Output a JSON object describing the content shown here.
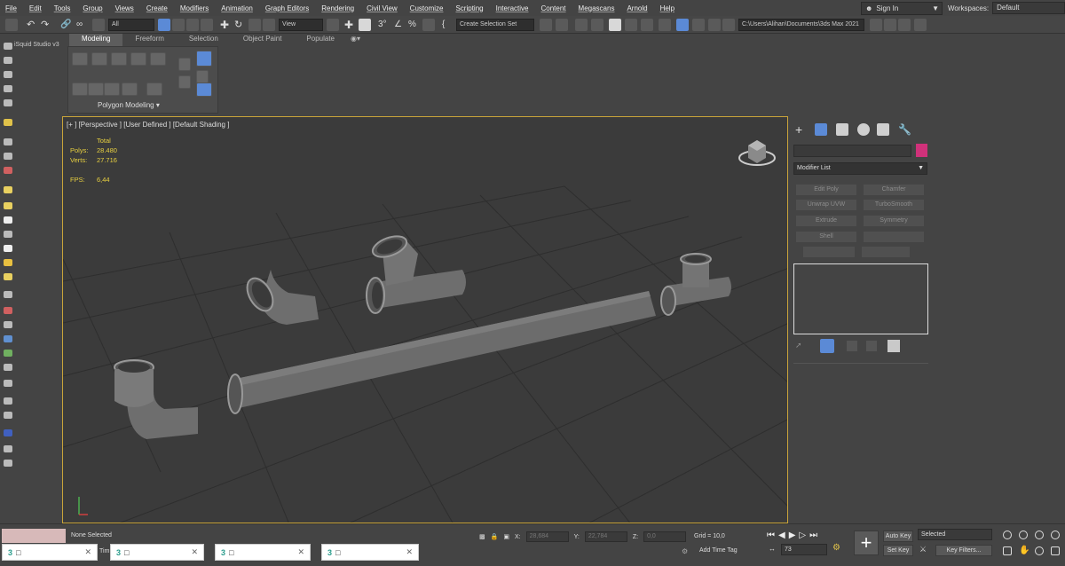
{
  "menu": [
    "File",
    "Edit",
    "Tools",
    "Group",
    "Views",
    "Create",
    "Modifiers",
    "Animation",
    "Graph Editors",
    "Rendering",
    "Civil View",
    "Customize",
    "Scripting",
    "Interactive",
    "Content",
    "Megascans",
    "Arnold",
    "Help"
  ],
  "account": {
    "signin": "Sign In",
    "workspaces_label": "Workspaces:",
    "workspace": "Default"
  },
  "toolbar": {
    "filter": "All",
    "ref_coord": "View",
    "selection_set": "Create Selection Set",
    "project_path": "C:\\Users\\Alihan\\Documents\\3ds Max 2021"
  },
  "ribbon": {
    "tabs": [
      "Modeling",
      "Freeform",
      "Selection",
      "Object Paint",
      "Populate"
    ],
    "active_tab": 0,
    "panel_label": "Polygon Modeling"
  },
  "left_panel": {
    "plugin_label": "iSquid Studio v3"
  },
  "viewport": {
    "label": "[+ ] [Perspective ] [User Defined ] [Default Shading ]",
    "stats_header": "Total",
    "polys_label": "Polys:",
    "polys": "28.480",
    "verts_label": "Verts:",
    "verts": "27.716",
    "fps_label": "FPS:",
    "fps": "6,44"
  },
  "command_panel": {
    "modifier_list": "Modifier List",
    "modifiers": [
      "Edit Poly",
      "Chamfer",
      "Unwrap UVW",
      "TurboSmooth",
      "Extrude",
      "Symmetry",
      "Shell",
      ""
    ],
    "swatch_color": "#d0317a"
  },
  "status": {
    "selection": "None Selected",
    "x_label": "X:",
    "x": "28,684",
    "y_label": "Y:",
    "y": "22,784",
    "z_label": "Z:",
    "z": "0,0",
    "grid": "Grid = 10,0",
    "add_time_tag": "Add Time Tag",
    "frame": "73",
    "auto_key": "Auto Key",
    "set_key": "Set Key",
    "key_mode": "Selected",
    "key_filters": "Key Filters...",
    "tim": "Tim"
  },
  "taskbar_icon": "3",
  "accent": "#c9a43a"
}
